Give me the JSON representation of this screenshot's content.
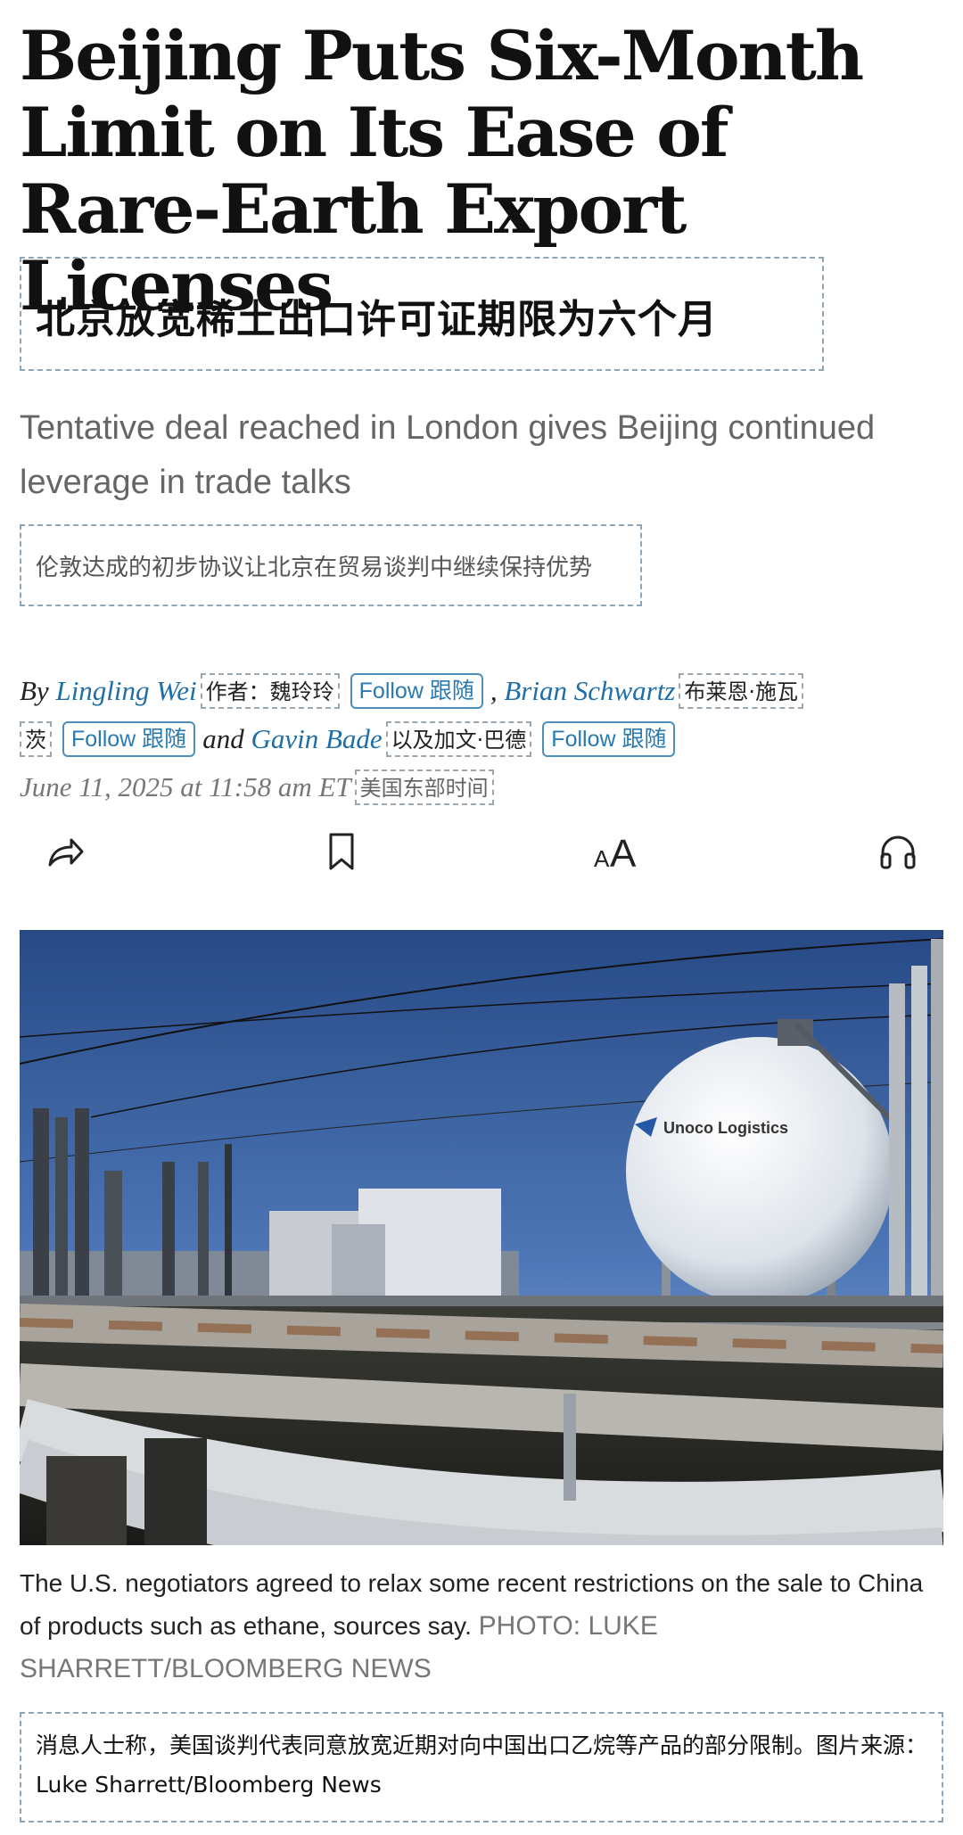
{
  "headline": "Beijing Puts Six-Month Limit on Its Ease of Rare-Earth Export Licenses",
  "headline_cn": "北京放宽稀土出口许可证期限为六个月",
  "dek": "Tentative deal reached in London gives Beijing continued leverage in trade talks",
  "dek_cn": "伦敦达成的初步协议让北京在贸易谈判中继续保持优势",
  "byline": {
    "by": "By",
    "author1": "Lingling Wei",
    "author1_cn": "作者：魏玲玲",
    "follow": "Follow 跟随",
    "comma": ",",
    "author2": "Brian Schwartz",
    "author2_cn_a": "布莱恩·施瓦",
    "author2_cn_b": "茨",
    "and": "and",
    "author3": "Gavin Bade",
    "author3_cn": "以及加文·巴德",
    "date": "June 11, 2025 at 11:58 am ET",
    "date_cn": "美国东部时间"
  },
  "actions": {
    "share": "share-icon",
    "bookmark": "bookmark-icon",
    "text_size": "text-size-icon",
    "listen": "headphones-icon"
  },
  "photo": {
    "tank_text": "Unoco Logistics"
  },
  "caption": {
    "text": "The U.S. negotiators agreed to relax some recent restrictions on the sale to China of products such as ethane, sources say.",
    "credit": "PHOTO: LUKE SHARRETT/BLOOMBERG NEWS",
    "cn": "消息人士称，美国谈判代表同意放宽近期对向中国出口乙烷等产品的部分限制。图片来源：Luke Sharrett/Bloomberg News"
  }
}
